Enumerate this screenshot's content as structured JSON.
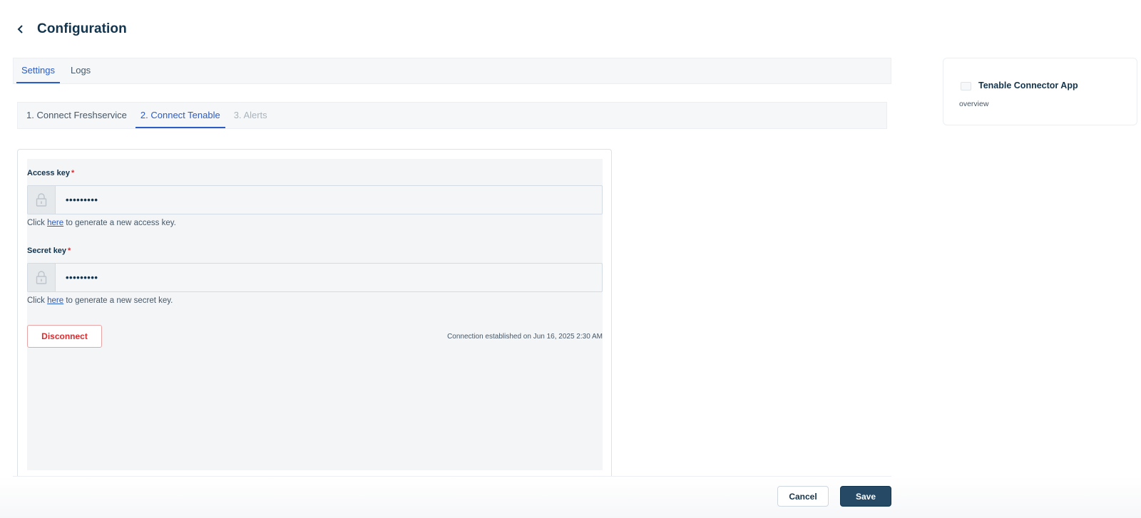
{
  "header": {
    "title": "Configuration",
    "back_icon": "chevron-left-icon"
  },
  "tabs": [
    {
      "label": "Settings",
      "active": true
    },
    {
      "label": "Logs",
      "active": false
    }
  ],
  "steps": [
    {
      "label": "1. Connect Freshservice",
      "state": "done"
    },
    {
      "label": "2. Connect Tenable",
      "state": "active"
    },
    {
      "label": "3. Alerts",
      "state": "disabled"
    }
  ],
  "form": {
    "access_key": {
      "label": "Access key",
      "required_mark": "*",
      "value": "•••••••••",
      "icon": "lock-icon",
      "help_prefix": "Click",
      "help_link": "here",
      "help_suffix": "to generate a new access key."
    },
    "secret_key": {
      "label": "Secret key",
      "required_mark": "*",
      "value": "•••••••••",
      "icon": "lock-icon",
      "help_prefix": "Click",
      "help_link": "here",
      "help_suffix": "to generate a new secret key."
    },
    "disconnect_label": "Disconnect",
    "connection_status": "Connection established on Jun 16, 2025 2:30 AM"
  },
  "footer": {
    "cancel_label": "Cancel",
    "save_label": "Save"
  },
  "app_card": {
    "name": "Tenable Connector App",
    "subtitle": "overview",
    "icon": "app-icon"
  },
  "colors": {
    "accent": "#2c5cc5",
    "primary_text": "#12344d",
    "danger": "#d72d30",
    "save_bg": "#264966"
  }
}
